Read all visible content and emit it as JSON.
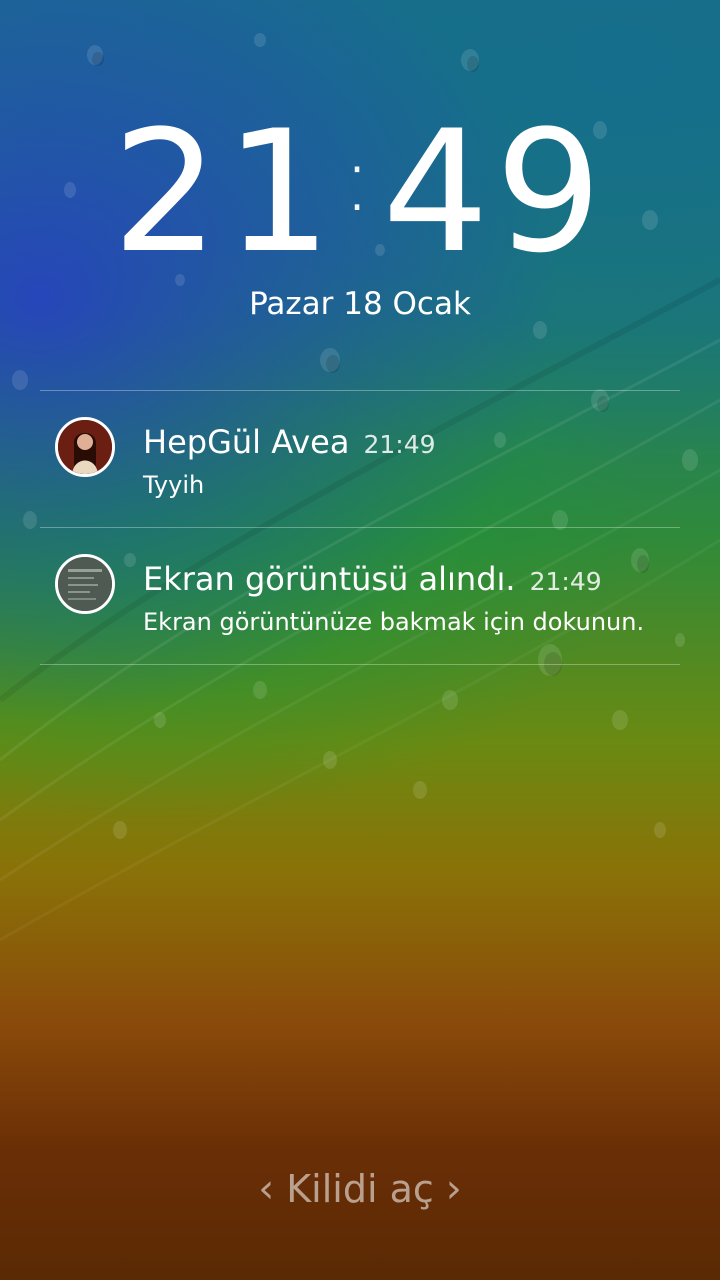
{
  "lockscreen": {
    "clock": {
      "hours": "21",
      "separator": ":",
      "minutes": "49"
    },
    "date": "Pazar 18 Ocak",
    "unlock": {
      "label": "Kilidi aç",
      "left_icon": "chevron-left-icon",
      "right_icon": "chevron-right-icon"
    }
  },
  "notifications": [
    {
      "title": "HepGül Avea",
      "time": "21:49",
      "text": "Tyyih",
      "icon": "contact-avatar"
    },
    {
      "title": "Ekran görüntüsü alındı.",
      "time": "21:49",
      "text": "Ekran görüntünüze bakmak için dokunun.",
      "icon": "screenshot-thumbnail"
    }
  ],
  "colors": {
    "text": "#ffffff",
    "divider": "rgba(255,255,255,0.32)",
    "unlock_text": "rgba(255,255,255,0.55)"
  }
}
